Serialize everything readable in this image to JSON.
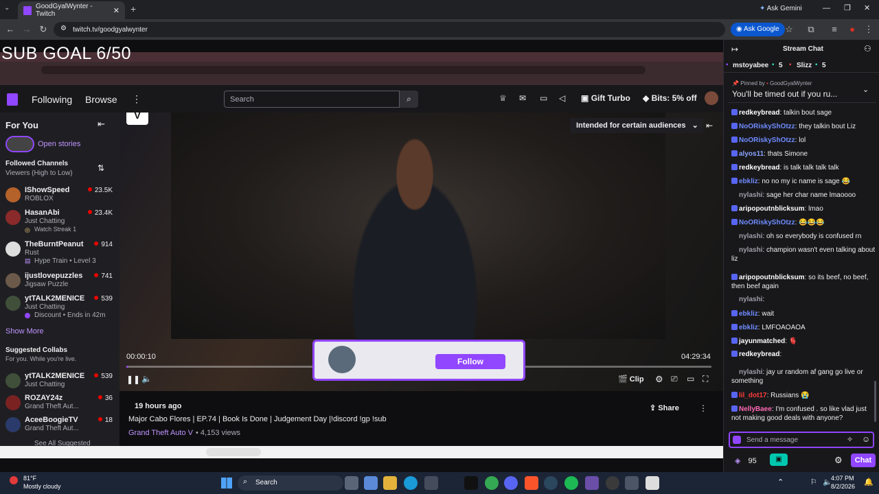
{
  "browser": {
    "tab_title": "GoodGyalWynter - Twitch",
    "url": "twitch.tv/goodgyalwynter",
    "ask_gemini": "Ask Gemini",
    "ask_google": "Ask Google"
  },
  "overlay": {
    "sub_goal": "SUB GOAL 6/50"
  },
  "twitch": {
    "nav_following": "Following",
    "nav_browse": "Browse",
    "search_placeholder": "Search",
    "gift_turbo": "Gift Turbo",
    "bits_offer": "Bits: 5% off"
  },
  "sidebar": {
    "title": "For You",
    "open_stories": "Open stories",
    "followed_heading": "Followed Channels",
    "followed_sort": "Viewers (High to Low)",
    "channels": [
      {
        "name": "IShowSpeed",
        "category": "ROBLOX",
        "viewers": "23.5K",
        "extra": ""
      },
      {
        "name": "HasanAbi",
        "category": "Just Chatting",
        "viewers": "23.4K",
        "extra": "Watch Streak 1"
      },
      {
        "name": "TheBurntPeanut",
        "category": "Rust",
        "viewers": "914",
        "extra": "Hype Train • Level 3"
      },
      {
        "name": "ijustlovepuzzles",
        "category": "Jigsaw Puzzle",
        "viewers": "741",
        "extra": ""
      },
      {
        "name": "ytTALK2MENICE",
        "category": "Just Chatting",
        "viewers": "539",
        "extra": "Discount • Ends in 42m"
      }
    ],
    "show_more": "Show More",
    "suggested_heading": "Suggested Collabs",
    "suggested_sub": "For you. While you're live.",
    "suggested": [
      {
        "name": "ytTALK2MENICE",
        "category": "Just Chatting",
        "viewers": "539"
      },
      {
        "name": "ROZAY24z",
        "category": "Grand Theft Aut...",
        "viewers": "36"
      },
      {
        "name": "AceeBoogieTV",
        "category": "Grand Theft Aut...",
        "viewers": "18"
      }
    ],
    "see_all": "See All Suggested"
  },
  "player": {
    "audience_label": "Intended for certain audiences",
    "time_current": "00:00:10",
    "time_total": "04:29:34",
    "progress_fraction": 0.001,
    "follow_button": "Follow",
    "clip_button": "Clip"
  },
  "video_info": {
    "age": "19 hours ago",
    "title": "Major Cabo Flores | EP.74 | Book Is Done | Judgement Day |!discord !gp !sub",
    "category": "Grand Theft Auto V",
    "views": "4,153 views",
    "share": "Share"
  },
  "chat": {
    "title": "Stream Chat",
    "gift_users": [
      {
        "name": "mstoyabee",
        "count": "5"
      },
      {
        "name": "Slizz",
        "count": "5"
      }
    ],
    "pinned_by_label": "Pinned by",
    "pinned_by": "GoodGyalWynter",
    "pinned_message": "You'll be timed out if you ru...",
    "messages": [
      {
        "user": "redkeybread",
        "text": ": talkin bout sage",
        "color": "#ffffff"
      },
      {
        "user": "NoORiskyShOtzz",
        "text": ": they talkin bout Liz",
        "color": "#6f8cff"
      },
      {
        "user": "NoORiskyShOtzz",
        "text": ": lol",
        "color": "#6f8cff"
      },
      {
        "user": "alyos11",
        "text": ": thats Simone",
        "color": "#8aa4ff"
      },
      {
        "user": "redkeybread",
        "text": ": is talk talk talk talk",
        "color": "#ffffff"
      },
      {
        "user": "ebkliz",
        "text": ": no no my ic name is sage 😂",
        "color": "#6f8cff"
      },
      {
        "user": "nylashi",
        "text": ": sage her char name lmaoooo",
        "color": "#9e9ea8"
      },
      {
        "user": "aripopoutnblicksum",
        "text": ": lmao",
        "color": "#ffffff"
      },
      {
        "user": "NoORiskyShOtzz",
        "text": ": 😂😂😂",
        "color": "#6f8cff"
      },
      {
        "user": "nylashi",
        "text": ": oh so everybody is confused rn",
        "color": "#9e9ea8"
      },
      {
        "user": "nylashi",
        "text": ": champion wasn't even talking about liz",
        "color": "#9e9ea8"
      },
      {
        "user": "aripopoutnblicksum",
        "text": ": so its beef, no beef, then beef again",
        "color": "#ffffff"
      },
      {
        "user": "nylashi",
        "text": ":",
        "color": "#9e9ea8"
      },
      {
        "user": "ebkliz",
        "text": ": wait",
        "color": "#6f8cff"
      },
      {
        "user": "ebkliz",
        "text": ": LMFOAOAOA",
        "color": "#6f8cff"
      },
      {
        "user": "jayunmatched",
        "text": ": 🫀",
        "color": "#ffffff"
      },
      {
        "user": "redkeybread",
        "text": ":",
        "color": "#ffffff"
      },
      {
        "user": "nylashi",
        "text": ": jay ur random af gang go live or something",
        "color": "#9e9ea8"
      },
      {
        "user": "lil_dot17",
        "text": ": Russians 😭",
        "color": "#ff3b3b"
      },
      {
        "user": "NellyBaee",
        "text": ": I'm confused . so like vlad just not making good deals with anyone?",
        "color": "#ff69b4"
      }
    ],
    "input_placeholder": "Send a message",
    "points": "95",
    "chat_button": "Chat"
  },
  "windows": {
    "weather_temp": "81°F",
    "weather_text": "Mostly cloudy",
    "search": "Search",
    "time": "4:07 PM",
    "date": "8/2/2026"
  }
}
